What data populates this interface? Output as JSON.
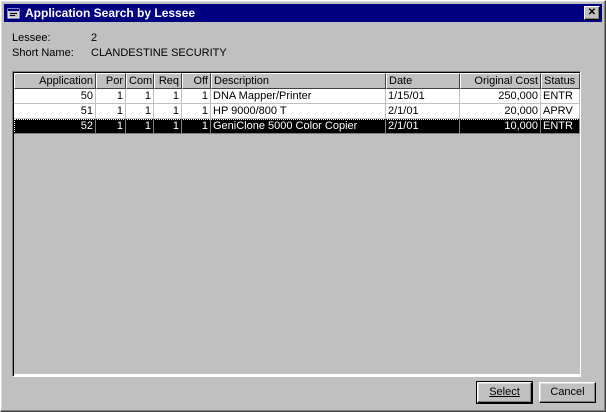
{
  "window": {
    "title": "Application Search by Lessee",
    "close_label": "✕"
  },
  "lessee": {
    "label": "Lessee:",
    "value": "2"
  },
  "short_name": {
    "label": "Short Name:",
    "value": "CLANDESTINE SECURITY"
  },
  "table": {
    "columns": [
      "Application",
      "Por",
      "Com",
      "Req",
      "Off",
      "Description",
      "Date",
      "Original Cost",
      "Status"
    ],
    "rows": [
      [
        "50",
        "1",
        "1",
        "1",
        "1",
        "DNA Mapper/Printer",
        "1/15/01",
        "250,000",
        "ENTR"
      ],
      [
        "51",
        "1",
        "1",
        "1",
        "1",
        "HP 9000/800 T",
        "2/1/01",
        "20,000",
        "APRV"
      ],
      [
        "52",
        "1",
        "1",
        "1",
        "1",
        "GeniClone 5000 Color Copier",
        "2/1/01",
        "10,000",
        "ENTR"
      ]
    ],
    "selected_row": 2
  },
  "buttons": {
    "select": "Select",
    "cancel": "Cancel"
  }
}
